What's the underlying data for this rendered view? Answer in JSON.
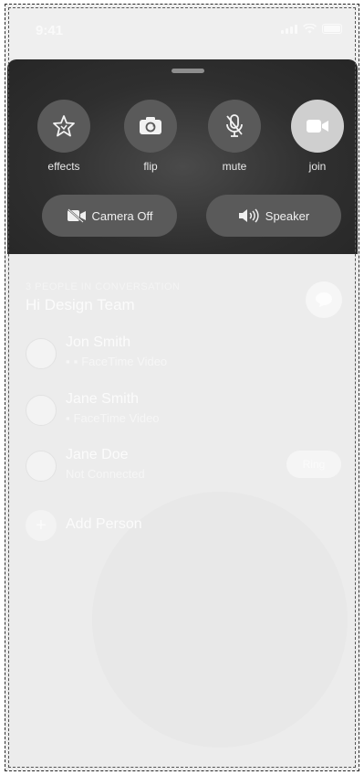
{
  "status_bar": {
    "time": "9:41"
  },
  "controls": [
    {
      "label": "effects",
      "icon": "star-effects-icon"
    },
    {
      "label": "flip",
      "icon": "camera-flip-icon"
    },
    {
      "label": "mute",
      "icon": "mic-off-icon"
    },
    {
      "label": "join",
      "icon": "video-camera-icon"
    }
  ],
  "pills": {
    "camera_off": "Camera Off",
    "speaker": "Speaker"
  },
  "conversation": {
    "caption": "3 PEOPLE IN CONVERSATION",
    "title": "Hi Design Team",
    "people": [
      {
        "name": "Jon Smith",
        "status": "FaceTime Video"
      },
      {
        "name": "Jane Smith",
        "status": "FaceTime Video"
      },
      {
        "name": "Jane Doe",
        "status": "Not Connected",
        "action": "Ring"
      }
    ],
    "add_person": "Add Person"
  },
  "colors": {
    "sheet_bg": "#2f2f2f",
    "control_circle": "#5a5a5a",
    "join_circle": "#cfcfcf",
    "list_bg": "#ececec"
  }
}
